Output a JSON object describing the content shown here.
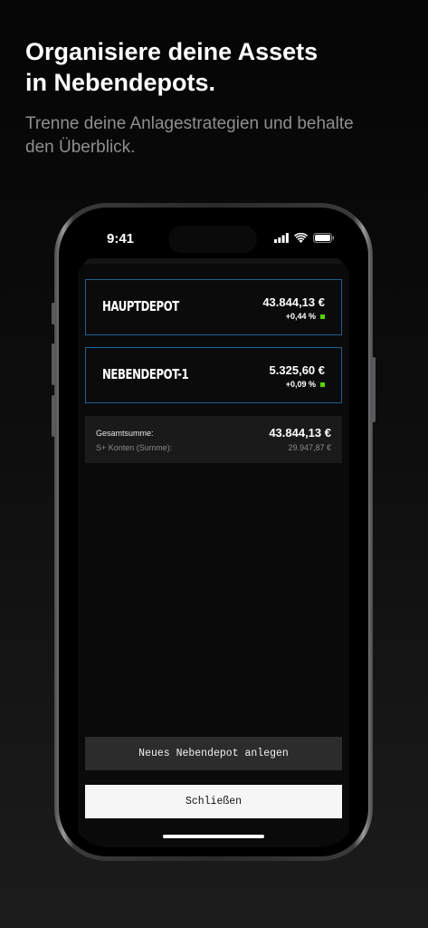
{
  "intro": {
    "headline_line1": "Organisiere deine Assets",
    "headline_line2": "in Nebendepots.",
    "subline_line1": "Trenne deine Anlagestrategien und behalte",
    "subline_line2": "den Überblick."
  },
  "status_bar": {
    "time": "9:41",
    "icons": [
      "cellular-signal-icon",
      "wifi-icon",
      "battery-icon"
    ]
  },
  "depots": [
    {
      "name": "HAUPTDEPOT",
      "value": "43.844,13 €",
      "change": "+0,44 %"
    },
    {
      "name": "NEBENDEPOT-1",
      "value": "5.325,60 €",
      "change": "+0,09 %"
    }
  ],
  "summary": {
    "total_label": "Gesamtsumme:",
    "total_value": "43.844,13 €",
    "splus_label": "S+ Konten (Summe):",
    "splus_value": "29.947,87 €"
  },
  "buttons": {
    "new_depot": "Neues Nebendepot anlegen",
    "close": "Schließen"
  },
  "colors": {
    "card_border": "#1f5f8f",
    "positive_indicator": "#55d400",
    "primary_button_bg": "#f6f6f6",
    "secondary_button_bg": "#2c2c2c"
  }
}
